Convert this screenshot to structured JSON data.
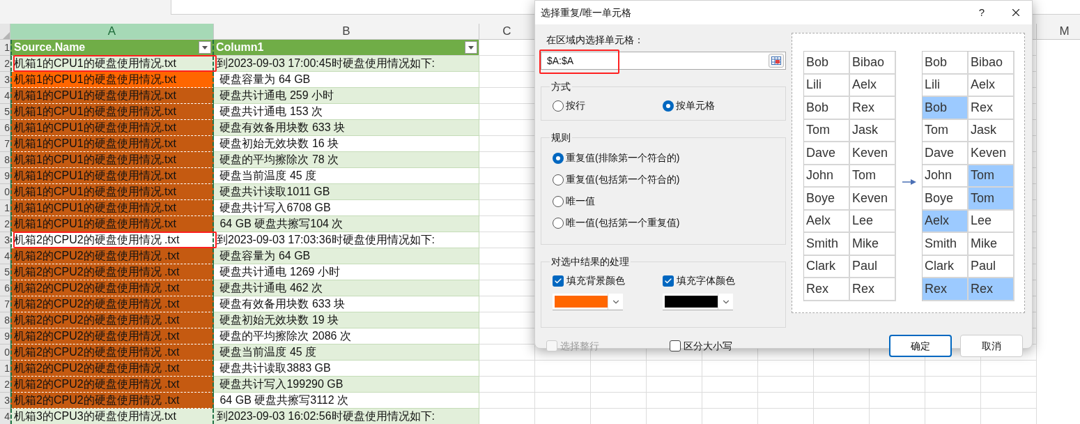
{
  "sheet": {
    "column_headers": [
      {
        "label": "A",
        "selected": true
      },
      {
        "label": "B",
        "selected": false
      },
      {
        "label": "C",
        "selected": false
      },
      {
        "label": "M",
        "selected": false
      }
    ],
    "header_row": {
      "row_label": "1",
      "cells": [
        "Source.Name",
        "Column1"
      ]
    },
    "rows": [
      {
        "row_label": "2",
        "a": {
          "text": "机箱1的CPU1的硬盘使用情况.txt",
          "outlined": true
        },
        "b": "到2023-09-03 17:00:45时硬盘使用情况如下:"
      },
      {
        "row_label": "3",
        "a": {
          "text": "机箱1的CPU1的硬盘使用情况.txt",
          "outlined": false,
          "color": "#ff6600"
        },
        "b": " 硬盘容量为 64 GB"
      },
      {
        "row_label": "4",
        "a": {
          "text": "机箱1的CPU1的硬盘使用情况.txt",
          "outlined": false,
          "color": "#c55a11"
        },
        "b": " 硬盘共计通电 259 小时"
      },
      {
        "row_label": "5",
        "a": {
          "text": "机箱1的CPU1的硬盘使用情况.txt",
          "outlined": false,
          "color": "#c55a11"
        },
        "b": " 硬盘共计通电 153 次"
      },
      {
        "row_label": "6",
        "a": {
          "text": "机箱1的CPU1的硬盘使用情况.txt",
          "outlined": false,
          "color": "#c55a11"
        },
        "b": " 硬盘有效备用块数 633 块"
      },
      {
        "row_label": "7",
        "a": {
          "text": "机箱1的CPU1的硬盘使用情况.txt",
          "outlined": false,
          "color": "#c55a11"
        },
        "b": " 硬盘初始无效块数 16 块"
      },
      {
        "row_label": "8",
        "a": {
          "text": "机箱1的CPU1的硬盘使用情况.txt",
          "outlined": false,
          "color": "#c55a11"
        },
        "b": " 硬盘的平均擦除次 78 次"
      },
      {
        "row_label": "9",
        "a": {
          "text": "机箱1的CPU1的硬盘使用情况.txt",
          "outlined": false,
          "color": "#c55a11"
        },
        "b": " 硬盘当前温度 45 度"
      },
      {
        "row_label": "0",
        "a": {
          "text": "机箱1的CPU1的硬盘使用情况.txt",
          "outlined": false,
          "color": "#c55a11"
        },
        "b": " 硬盘共计读取1011 GB"
      },
      {
        "row_label": "1",
        "a": {
          "text": "机箱1的CPU1的硬盘使用情况.txt",
          "outlined": false,
          "color": "#c55a11"
        },
        "b": " 硬盘共计写入6708 GB"
      },
      {
        "row_label": "2",
        "a": {
          "text": "机箱1的CPU1的硬盘使用情况.txt",
          "outlined": false,
          "color": "#c55a11"
        },
        "b": " 64 GB 硬盘共擦写104 次"
      },
      {
        "row_label": "3",
        "a": {
          "text": "机箱2的CPU2的硬盘使用情况 .txt",
          "outlined": true
        },
        "b": "到2023-09-03 17:03:36时硬盘使用情况如下:"
      },
      {
        "row_label": "4",
        "a": {
          "text": "机箱2的CPU2的硬盘使用情况 .txt",
          "outlined": false,
          "color": "#c55a11"
        },
        "b": " 硬盘容量为 64 GB"
      },
      {
        "row_label": "5",
        "a": {
          "text": "机箱2的CPU2的硬盘使用情况 .txt",
          "outlined": false,
          "color": "#c55a11"
        },
        "b": " 硬盘共计通电 1269 小时"
      },
      {
        "row_label": "6",
        "a": {
          "text": "机箱2的CPU2的硬盘使用情况 .txt",
          "outlined": false,
          "color": "#c55a11"
        },
        "b": " 硬盘共计通电 462 次"
      },
      {
        "row_label": "7",
        "a": {
          "text": "机箱2的CPU2的硬盘使用情况 .txt",
          "outlined": false,
          "color": "#c55a11"
        },
        "b": " 硬盘有效备用块数 633 块"
      },
      {
        "row_label": "8",
        "a": {
          "text": "机箱2的CPU2的硬盘使用情况 .txt",
          "outlined": false,
          "color": "#c55a11"
        },
        "b": " 硬盘初始无效块数 19 块"
      },
      {
        "row_label": "9",
        "a": {
          "text": "机箱2的CPU2的硬盘使用情况 .txt",
          "outlined": false,
          "color": "#c55a11"
        },
        "b": " 硬盘的平均擦除次 2086 次"
      },
      {
        "row_label": "0",
        "a": {
          "text": "机箱2的CPU2的硬盘使用情况 .txt",
          "outlined": false,
          "color": "#c55a11"
        },
        "b": " 硬盘当前温度 45 度"
      },
      {
        "row_label": "1",
        "a": {
          "text": "机箱2的CPU2的硬盘使用情况 .txt",
          "outlined": false,
          "color": "#c55a11"
        },
        "b": " 硬盘共计读取3883 GB"
      },
      {
        "row_label": "2",
        "a": {
          "text": "机箱2的CPU2的硬盘使用情况 .txt",
          "outlined": false,
          "color": "#c55a11"
        },
        "b": " 硬盘共计写入199290 GB"
      },
      {
        "row_label": "3",
        "a": {
          "text": "机箱2的CPU2的硬盘使用情况 .txt",
          "outlined": false,
          "color": "#c55a11"
        },
        "b": " 64 GB 硬盘共擦写3112 次"
      },
      {
        "row_label": "4",
        "a": {
          "text": "机箱3的CPU3的硬盘使用情况.txt",
          "outlined": false
        },
        "b": "到2023-09-03 16:02:56时硬盘使用情况如下:"
      }
    ]
  },
  "dialog": {
    "title": "选择重复/唯一单元格",
    "help": "?",
    "range_label": "在区域内选择单元格：",
    "range_field": {
      "value": "$A:$A",
      "annotated": true
    },
    "groups": [
      {
        "title": "方式",
        "kind": "radio_row",
        "options": [
          {
            "label": "按行",
            "selected": false
          },
          {
            "label": "按单元格",
            "selected": true
          }
        ]
      },
      {
        "title": "规则",
        "kind": "radio_list",
        "options": [
          {
            "label": "重复值(排除第一个符合的)",
            "selected": true
          },
          {
            "label": "重复值(包括第一个符合的)",
            "selected": false
          },
          {
            "label": "唯一值",
            "selected": false
          },
          {
            "label": "唯一值(包括第一个重复值)",
            "selected": false
          }
        ]
      },
      {
        "title": "对选中结果的处理",
        "kind": "checkbox_colors",
        "options": [
          {
            "label": "填充背景颜色",
            "checked": true,
            "color": "#ff6600"
          },
          {
            "label": "填充字体颜色",
            "checked": true,
            "color": "#000000"
          }
        ]
      }
    ],
    "bottom_options": [
      {
        "label": "选择整行",
        "checked": false,
        "disabled": true
      },
      {
        "label": "区分大小写",
        "checked": false,
        "disabled": false
      }
    ],
    "preview": {
      "before": [
        [
          "Bob",
          "Bibao"
        ],
        [
          "Lili",
          "Aelx"
        ],
        [
          "Bob",
          "Rex"
        ],
        [
          "Tom",
          "Jask"
        ],
        [
          "Dave",
          "Keven"
        ],
        [
          "John",
          "Tom"
        ],
        [
          "Boye",
          "Keven"
        ],
        [
          "Aelx",
          "Lee"
        ],
        [
          "Smith",
          "Mike"
        ],
        [
          "Clark",
          "Paul"
        ],
        [
          "Rex",
          "Rex"
        ]
      ],
      "after": [
        [
          {
            "text": "Bob",
            "highlighted": false
          },
          {
            "text": "Bibao",
            "highlighted": false
          }
        ],
        [
          {
            "text": "Lili",
            "highlighted": false
          },
          {
            "text": "Aelx",
            "highlighted": false
          }
        ],
        [
          {
            "text": "Bob",
            "highlighted": true
          },
          {
            "text": "Rex",
            "highlighted": false
          }
        ],
        [
          {
            "text": "Tom",
            "highlighted": false
          },
          {
            "text": "Jask",
            "highlighted": false
          }
        ],
        [
          {
            "text": "Dave",
            "highlighted": false
          },
          {
            "text": "Keven",
            "highlighted": false
          }
        ],
        [
          {
            "text": "John",
            "highlighted": false
          },
          {
            "text": "Tom",
            "highlighted": true
          }
        ],
        [
          {
            "text": "Boye",
            "highlighted": false
          },
          {
            "text": "Tom",
            "highlighted": true
          }
        ],
        [
          {
            "text": "Aelx",
            "highlighted": true
          },
          {
            "text": "Lee",
            "highlighted": false
          }
        ],
        [
          {
            "text": "Smith",
            "highlighted": false
          },
          {
            "text": "Mike",
            "highlighted": false
          }
        ],
        [
          {
            "text": "Clark",
            "highlighted": false
          },
          {
            "text": "Paul",
            "highlighted": false
          }
        ],
        [
          {
            "text": "Rex",
            "highlighted": true
          },
          {
            "text": "Rex",
            "highlighted": true
          }
        ]
      ]
    },
    "buttons": [
      {
        "label": "确定",
        "primary": true
      },
      {
        "label": "取消",
        "primary": false
      }
    ]
  }
}
